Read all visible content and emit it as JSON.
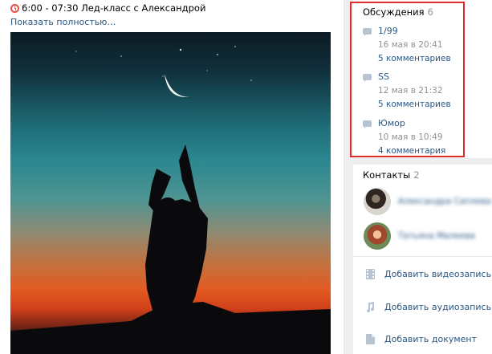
{
  "post": {
    "event_line": "6:00 - 07:30 Лед-класс с Александрой",
    "show_more": "Показать полностью…"
  },
  "discussions": {
    "title": "Обсуждения",
    "count": "6",
    "items": [
      {
        "title": "1/99",
        "date": "16 мая в 20:41",
        "comments": "5 комментариев"
      },
      {
        "title": "SS",
        "date": "12 мая в 21:32",
        "comments": "5 комментариев"
      },
      {
        "title": "Юмор",
        "date": "10 мая в 10:49",
        "comments": "4 комментария"
      }
    ]
  },
  "contacts": {
    "title": "Контакты",
    "count": "2",
    "items": [
      {
        "name": "Александра Саплева"
      },
      {
        "name": "Татьяна Малеева"
      }
    ]
  },
  "actions": {
    "add_video": "Добавить видеозапись",
    "add_audio": "Добавить аудиозапись",
    "add_document": "Добавить документ"
  },
  "colors": {
    "link": "#2a5885",
    "highlight_frame": "#e02b2b",
    "icon": "#b7c3d1"
  }
}
